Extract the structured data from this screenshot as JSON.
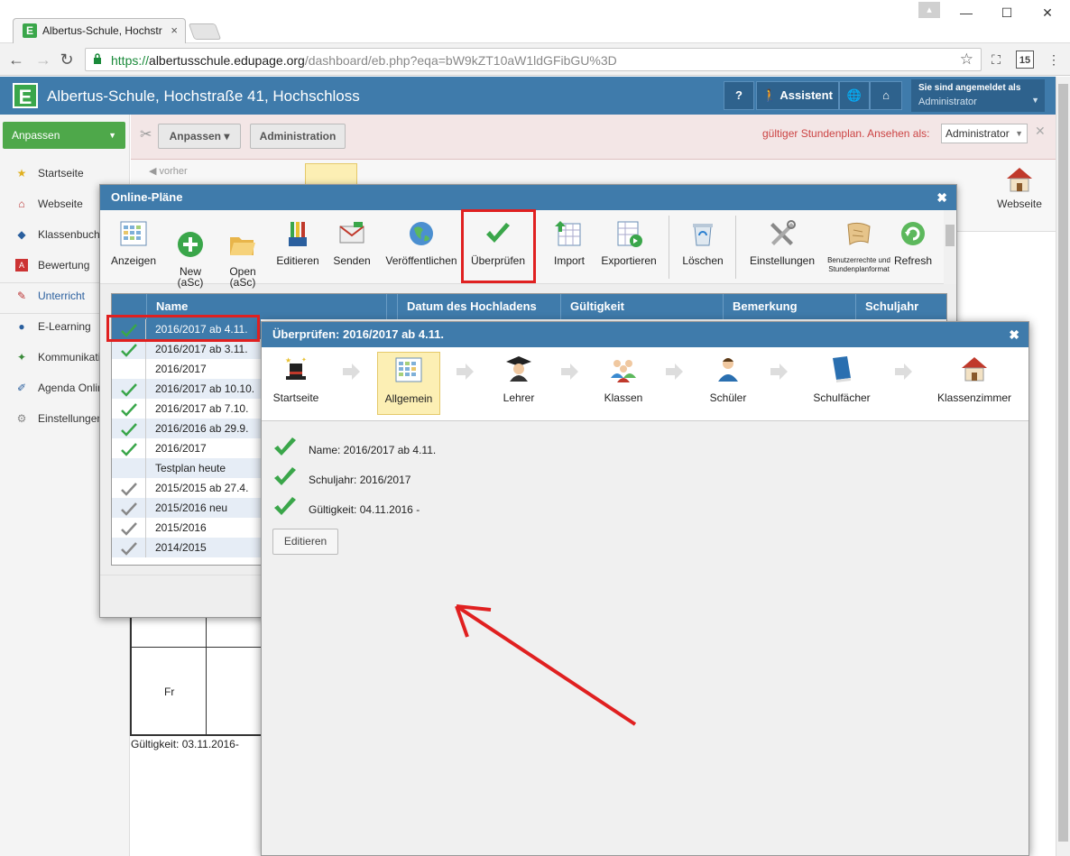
{
  "browser": {
    "tab_title": "Albertus-Schule, Hochstr",
    "tab_favicon": "E",
    "url_secure": "https://",
    "url_host": "albertusschule.edupage.org",
    "url_path": "/dashboard/eb.php?eqa=bW9kZT10aW1ldGFibGU%3D",
    "calendar_badge": "15"
  },
  "app": {
    "logo": "E",
    "title": "Albertus-Schule, Hochstraße 41, Hochschloss",
    "help_label": "?",
    "assistent_label": "Assistent",
    "login_line1": "Sie sind angemeldet als",
    "login_line2": "Administrator"
  },
  "sidebar": {
    "customize_label": "Anpassen",
    "items": [
      {
        "label": "Startseite"
      },
      {
        "label": "Webseite"
      },
      {
        "label": "Klassenbuch"
      },
      {
        "label": "Bewertung"
      },
      {
        "label": "Unterricht"
      },
      {
        "label": "E-Learning"
      },
      {
        "label": "Kommunikation"
      },
      {
        "label": "Agenda Online"
      },
      {
        "label": "Einstellungen"
      }
    ]
  },
  "toolbar": {
    "anpassen_label": "Anpassen ▾",
    "administration_label": "Administration",
    "warning": "gültiger Stundenplan.  Ansehen als:",
    "view_as": "Administrator",
    "vorher_label": "vorher",
    "webseite_label": "Webseite"
  },
  "background": {
    "day": "Fr",
    "validity": "Gültigkeit: 03.11.2016-"
  },
  "dialog_plans": {
    "title": "Online-Pläne",
    "tools": [
      {
        "label": "Anzeigen"
      },
      {
        "label": "New\n(aSc)"
      },
      {
        "label": "Open\n(aSc)"
      },
      {
        "label": "Editieren"
      },
      {
        "label": "Senden"
      },
      {
        "label": "Veröffentlichen"
      },
      {
        "label": "Überprüfen"
      },
      {
        "label": "Import"
      },
      {
        "label": "Exportieren"
      },
      {
        "label": "Löschen"
      },
      {
        "label": "Einstellungen"
      },
      {
        "label": "Benutzerrechte und Stundenplanformat"
      },
      {
        "label": "Refresh"
      }
    ],
    "columns": [
      "Name",
      "Datum des Hochladens",
      "Gültigkeit",
      "Bemerkung",
      "Schuljahr"
    ],
    "rows": [
      {
        "name": "2016/2017 ab 4.11.",
        "check": "green"
      },
      {
        "name": "2016/2017 ab 3.11.",
        "check": "green"
      },
      {
        "name": "2016/2017",
        "check": "none"
      },
      {
        "name": "2016/2017 ab 10.10.",
        "check": "green"
      },
      {
        "name": "2016/2017 ab 7.10.",
        "check": "green"
      },
      {
        "name": "2016/2016 ab 29.9.",
        "check": "green"
      },
      {
        "name": "2016/2017",
        "check": "green"
      },
      {
        "name": "Testplan heute",
        "check": "none"
      },
      {
        "name": "2015/2015 ab 27.4.",
        "check": "gray"
      },
      {
        "name": "2015/2016 neu",
        "check": "gray"
      },
      {
        "name": "2015/2016",
        "check": "gray"
      },
      {
        "name": "2014/2015",
        "check": "gray"
      }
    ]
  },
  "dialog_check": {
    "title": "Überprüfen: 2016/2017 ab 4.11.",
    "steps": [
      {
        "label": "Startseite"
      },
      {
        "label": "Allgemein"
      },
      {
        "label": "Lehrer"
      },
      {
        "label": "Klassen"
      },
      {
        "label": "Schüler"
      },
      {
        "label": "Schulfächer"
      },
      {
        "label": "Klassenzimmer"
      }
    ],
    "info": [
      {
        "text": "Name: 2016/2017 ab 4.11."
      },
      {
        "text": "Schuljahr: 2016/2017"
      },
      {
        "text": "Gültigkeit: 04.11.2016 -"
      }
    ],
    "edit_label": "Editieren"
  },
  "colors": {
    "header_blue": "#3f7bab",
    "green": "#4ea84a",
    "highlight_red": "#e02020"
  }
}
